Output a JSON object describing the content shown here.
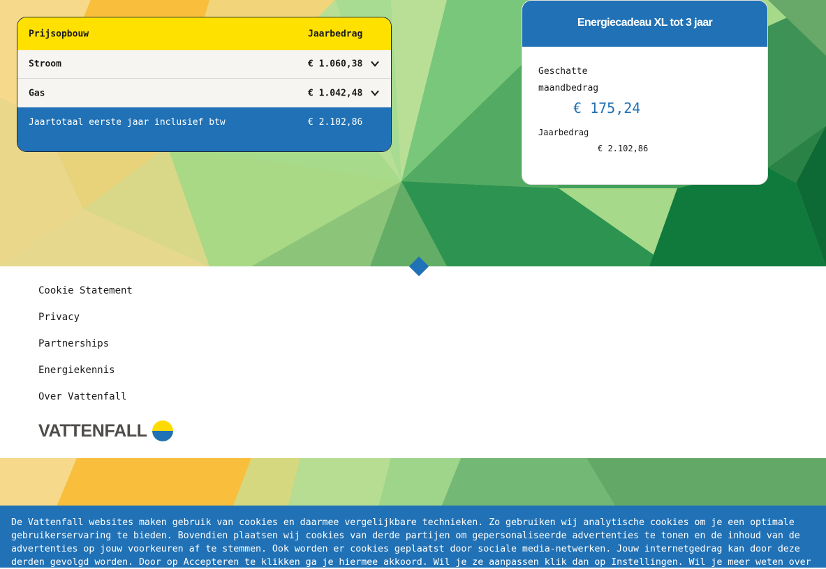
{
  "price_table": {
    "header_label": "Prijsopbouw",
    "header_amount": "Jaarbedrag",
    "rows": [
      {
        "label": "Stroom",
        "amount": "€ 1.060,38"
      },
      {
        "label": "Gas",
        "amount": "€ 1.042,48"
      }
    ],
    "total_label": "Jaartotaal eerste jaar inclusief btw",
    "total_amount": "€ 2.102,86"
  },
  "offer": {
    "title": "Energiecadeau XL tot 3 jaar",
    "monthly_label_1": "Geschatte",
    "monthly_label_2": "maandbedrag",
    "monthly_amount": "€ 175,24",
    "yearly_label": "Jaarbedrag",
    "yearly_amount": "€ 2.102,86"
  },
  "footer": {
    "links": [
      "Cookie Statement",
      "Privacy",
      "Partnerships",
      "Energiekennis",
      "Over Vattenfall"
    ],
    "logo_text": "VATTENFALL"
  },
  "cookie_banner": {
    "text": "De Vattenfall websites maken gebruik van cookies en daarmee vergelijkbare technieken. Zo gebruiken wij analytische cookies om je een optimale gebruikerservaring te bieden. Bovendien plaatsen wij cookies van derde partijen om gepersonaliseerde advertenties te tonen en de inhoud van de advertenties op jouw voorkeuren af te stemmen. Ook worden er cookies geplaatst door sociale media-netwerken. Jouw internetgedrag kan door deze derden gevolgd worden. Door op Accepteren te klikken ga je hiermee akkoord. Wil je ze aanpassen klik dan op Instellingen. Wil je meer weten over"
  },
  "colors": {
    "brand_blue": "#2071b5",
    "brand_yellow": "#ffe100",
    "logo_grey": "#4e4b48"
  },
  "icons": [
    "chevron-down-icon",
    "vattenfall-logo-icon"
  ]
}
